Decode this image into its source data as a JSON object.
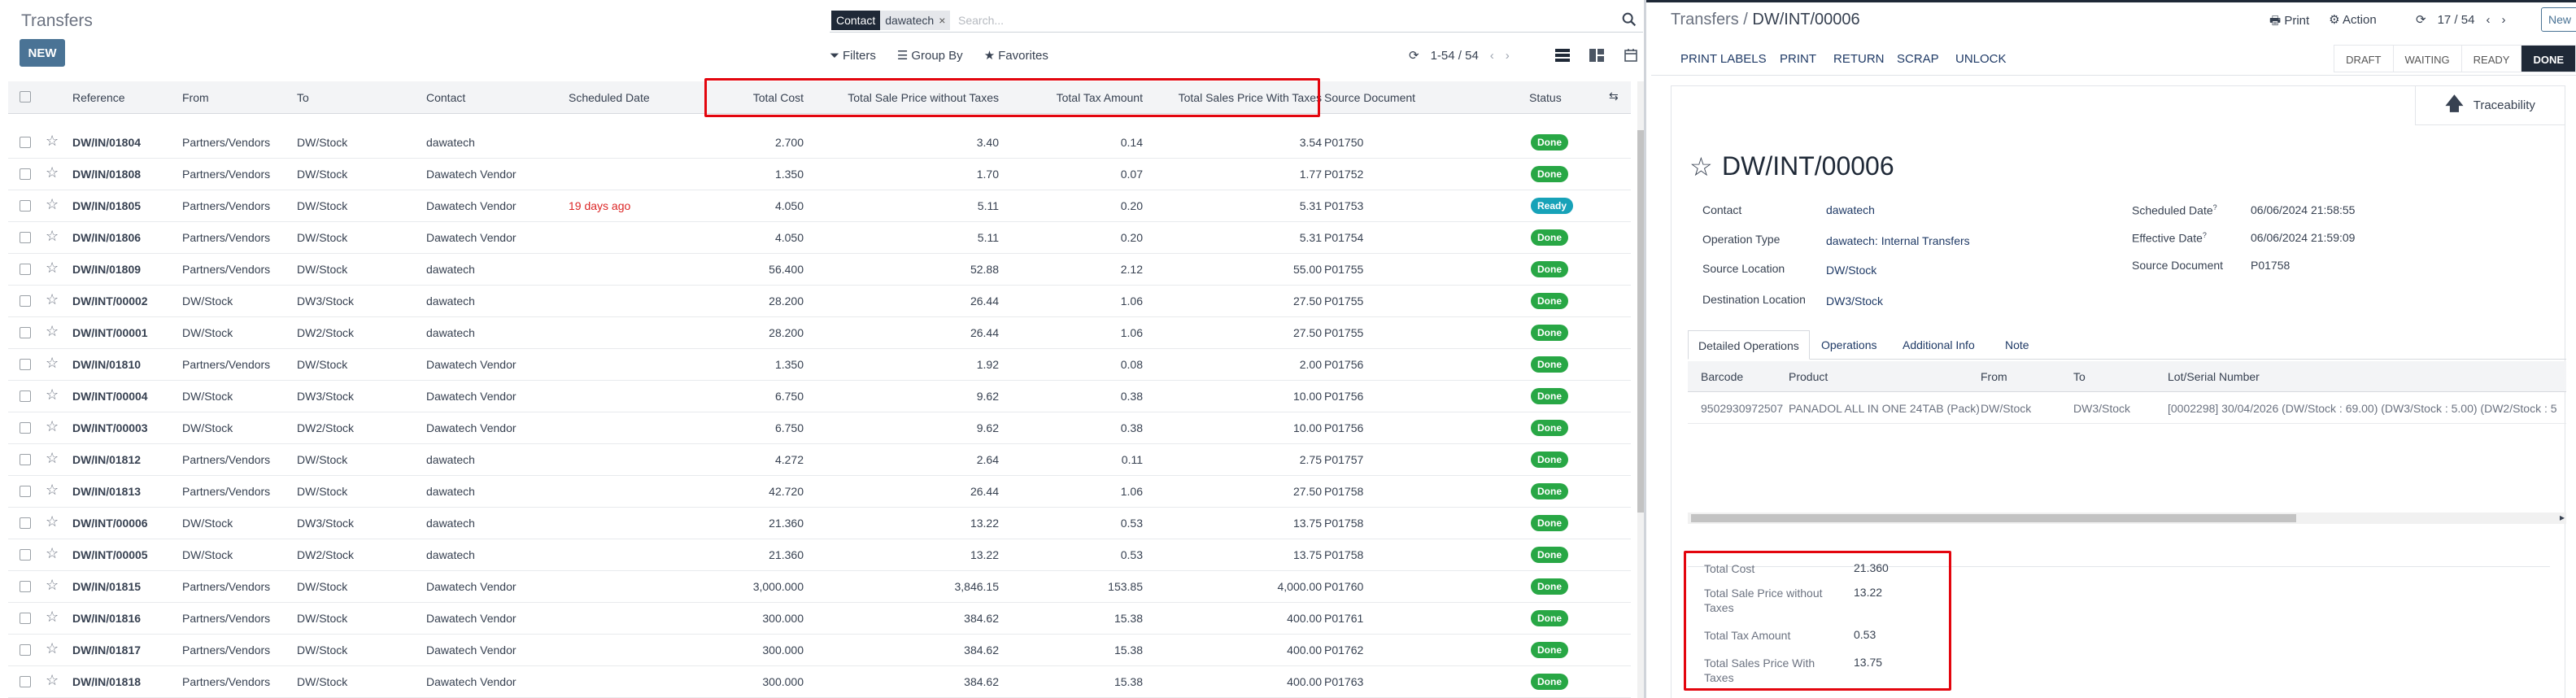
{
  "colors": {
    "primary": "#4a7395",
    "done": "#28a745",
    "ready": "#17a2b8",
    "highlight": "#e3050e",
    "late": "#dc2626"
  },
  "list": {
    "title": "Transfers",
    "new_label": "NEW",
    "search": {
      "facet_label": "Contact",
      "facet_value": "dawatech",
      "placeholder": "Search..."
    },
    "filters_label": "Filters",
    "group_by_label": "Group By",
    "favorites_label": "Favorites",
    "pager": "1-54 / 54",
    "columns": {
      "reference": "Reference",
      "from": "From",
      "to": "To",
      "contact": "Contact",
      "scheduled_date": "Scheduled Date",
      "total_cost": "Total Cost",
      "sale_wo_tax": "Total Sale Price without Taxes",
      "tax": "Total Tax Amount",
      "sale_with_tax": "Total Sales Price With Taxes",
      "source": "Source Document",
      "status": "Status"
    },
    "rows": [
      {
        "ref": "DW/IN/01804",
        "from": "Partners/Vendors",
        "to": "DW/Stock",
        "contact": "dawatech",
        "sched": "",
        "cost": "2.700",
        "wo": "3.40",
        "tax": "0.14",
        "with": "3.54",
        "src": "P01750",
        "status": "Done"
      },
      {
        "ref": "DW/IN/01808",
        "from": "Partners/Vendors",
        "to": "DW/Stock",
        "contact": "Dawatech Vendor",
        "sched": "",
        "cost": "1.350",
        "wo": "1.70",
        "tax": "0.07",
        "with": "1.77",
        "src": "P01752",
        "status": "Done"
      },
      {
        "ref": "DW/IN/01805",
        "from": "Partners/Vendors",
        "to": "DW/Stock",
        "contact": "Dawatech Vendor",
        "sched": "19 days ago",
        "cost": "4.050",
        "wo": "5.11",
        "tax": "0.20",
        "with": "5.31",
        "src": "P01753",
        "status": "Ready"
      },
      {
        "ref": "DW/IN/01806",
        "from": "Partners/Vendors",
        "to": "DW/Stock",
        "contact": "Dawatech Vendor",
        "sched": "",
        "cost": "4.050",
        "wo": "5.11",
        "tax": "0.20",
        "with": "5.31",
        "src": "P01754",
        "status": "Done"
      },
      {
        "ref": "DW/IN/01809",
        "from": "Partners/Vendors",
        "to": "DW/Stock",
        "contact": "dawatech",
        "sched": "",
        "cost": "56.400",
        "wo": "52.88",
        "tax": "2.12",
        "with": "55.00",
        "src": "P01755",
        "status": "Done"
      },
      {
        "ref": "DW/INT/00002",
        "from": "DW/Stock",
        "to": "DW3/Stock",
        "contact": "dawatech",
        "sched": "",
        "cost": "28.200",
        "wo": "26.44",
        "tax": "1.06",
        "with": "27.50",
        "src": "P01755",
        "status": "Done"
      },
      {
        "ref": "DW/INT/00001",
        "from": "DW/Stock",
        "to": "DW2/Stock",
        "contact": "dawatech",
        "sched": "",
        "cost": "28.200",
        "wo": "26.44",
        "tax": "1.06",
        "with": "27.50",
        "src": "P01755",
        "status": "Done"
      },
      {
        "ref": "DW/IN/01810",
        "from": "Partners/Vendors",
        "to": "DW/Stock",
        "contact": "Dawatech Vendor",
        "sched": "",
        "cost": "1.350",
        "wo": "1.92",
        "tax": "0.08",
        "with": "2.00",
        "src": "P01756",
        "status": "Done"
      },
      {
        "ref": "DW/INT/00004",
        "from": "DW/Stock",
        "to": "DW3/Stock",
        "contact": "Dawatech Vendor",
        "sched": "",
        "cost": "6.750",
        "wo": "9.62",
        "tax": "0.38",
        "with": "10.00",
        "src": "P01756",
        "status": "Done"
      },
      {
        "ref": "DW/INT/00003",
        "from": "DW/Stock",
        "to": "DW2/Stock",
        "contact": "Dawatech Vendor",
        "sched": "",
        "cost": "6.750",
        "wo": "9.62",
        "tax": "0.38",
        "with": "10.00",
        "src": "P01756",
        "status": "Done"
      },
      {
        "ref": "DW/IN/01812",
        "from": "Partners/Vendors",
        "to": "DW/Stock",
        "contact": "dawatech",
        "sched": "",
        "cost": "4.272",
        "wo": "2.64",
        "tax": "0.11",
        "with": "2.75",
        "src": "P01757",
        "status": "Done"
      },
      {
        "ref": "DW/IN/01813",
        "from": "Partners/Vendors",
        "to": "DW/Stock",
        "contact": "dawatech",
        "sched": "",
        "cost": "42.720",
        "wo": "26.44",
        "tax": "1.06",
        "with": "27.50",
        "src": "P01758",
        "status": "Done"
      },
      {
        "ref": "DW/INT/00006",
        "from": "DW/Stock",
        "to": "DW3/Stock",
        "contact": "dawatech",
        "sched": "",
        "cost": "21.360",
        "wo": "13.22",
        "tax": "0.53",
        "with": "13.75",
        "src": "P01758",
        "status": "Done"
      },
      {
        "ref": "DW/INT/00005",
        "from": "DW/Stock",
        "to": "DW2/Stock",
        "contact": "dawatech",
        "sched": "",
        "cost": "21.360",
        "wo": "13.22",
        "tax": "0.53",
        "with": "13.75",
        "src": "P01758",
        "status": "Done"
      },
      {
        "ref": "DW/IN/01815",
        "from": "Partners/Vendors",
        "to": "DW/Stock",
        "contact": "Dawatech Vendor",
        "sched": "",
        "cost": "3,000.000",
        "wo": "3,846.15",
        "tax": "153.85",
        "with": "4,000.00",
        "src": "P01760",
        "status": "Done"
      },
      {
        "ref": "DW/IN/01816",
        "from": "Partners/Vendors",
        "to": "DW/Stock",
        "contact": "Dawatech Vendor",
        "sched": "",
        "cost": "300.000",
        "wo": "384.62",
        "tax": "15.38",
        "with": "400.00",
        "src": "P01761",
        "status": "Done"
      },
      {
        "ref": "DW/IN/01817",
        "from": "Partners/Vendors",
        "to": "DW/Stock",
        "contact": "Dawatech Vendor",
        "sched": "",
        "cost": "300.000",
        "wo": "384.62",
        "tax": "15.38",
        "with": "400.00",
        "src": "P01762",
        "status": "Done"
      },
      {
        "ref": "DW/IN/01818",
        "from": "Partners/Vendors",
        "to": "DW/Stock",
        "contact": "Dawatech Vendor",
        "sched": "",
        "cost": "300.000",
        "wo": "384.62",
        "tax": "15.38",
        "with": "400.00",
        "src": "P01763",
        "status": "Done"
      }
    ]
  },
  "form": {
    "breadcrumb_root": "Transfers",
    "breadcrumb_sep": " / ",
    "breadcrumb_current": "DW/INT/00006",
    "print_label": "Print",
    "action_label": "Action",
    "pager": "17 / 54",
    "new_label": "New",
    "buttons": [
      "PRINT LABELS",
      "PRINT",
      "RETURN",
      "SCRAP",
      "UNLOCK"
    ],
    "statuses": [
      "DRAFT",
      "WAITING",
      "READY",
      "DONE"
    ],
    "traceability_label": "Traceability",
    "name": "DW/INT/00006",
    "fields_left": [
      {
        "label": "Contact",
        "value": "dawatech"
      },
      {
        "label": "Operation Type",
        "value": "dawatech: Internal Transfers"
      },
      {
        "label": "Source Location",
        "value": "DW/Stock"
      },
      {
        "label": "Destination Location",
        "value": "DW3/Stock"
      }
    ],
    "fields_right": [
      {
        "label": "Scheduled Date",
        "value": "06/06/2024 21:58:55"
      },
      {
        "label": "Effective Date",
        "value": "06/06/2024 21:59:09"
      },
      {
        "label": "Source Document",
        "value": "P01758"
      }
    ],
    "help_mark": "?",
    "tabs": [
      "Detailed Operations",
      "Operations",
      "Additional Info",
      "Note"
    ],
    "ops_columns": {
      "barcode": "Barcode",
      "product": "Product",
      "from": "From",
      "to": "To",
      "lot": "Lot/Serial Number"
    },
    "ops_row": {
      "barcode": "9502930972507",
      "product": "PANADOL ALL IN ONE 24TAB (Pack)",
      "from": "DW/Stock",
      "to": "DW3/Stock",
      "lot": "[0002298] 30/04/2026 (DW/Stock : 69.00) (DW3/Stock : 5.00) (DW2/Stock : 5"
    },
    "totals": [
      {
        "label": "Total Cost",
        "value": "21.360"
      },
      {
        "label": "Total Sale Price without Taxes",
        "value": "13.22"
      },
      {
        "label": "Total Tax Amount",
        "value": "0.53"
      },
      {
        "label": "Total Sales Price With Taxes",
        "value": "13.75"
      }
    ]
  }
}
